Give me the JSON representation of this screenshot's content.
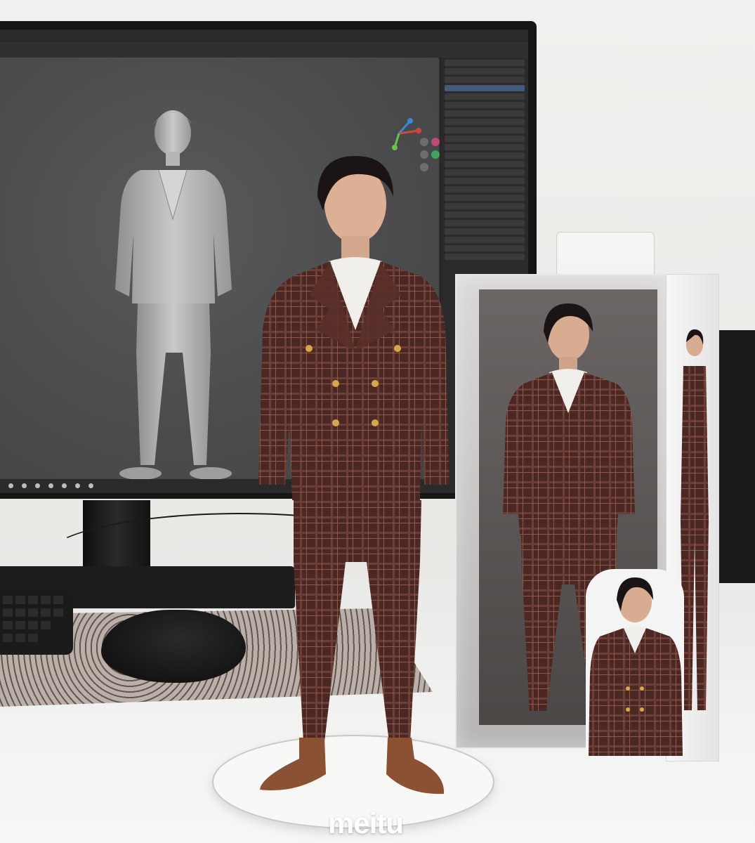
{
  "watermark": "meitu",
  "scene": {
    "colors": {
      "suit": "#4e2a26",
      "suit_plaid": "#7a4a40",
      "sculpt_gray": "#b8b8b8",
      "shoes": "#8a5232",
      "viewport": "#4b4c4d"
    }
  },
  "icons": [
    "monitor-icon",
    "mouse-icon",
    "keyboard-icon"
  ]
}
